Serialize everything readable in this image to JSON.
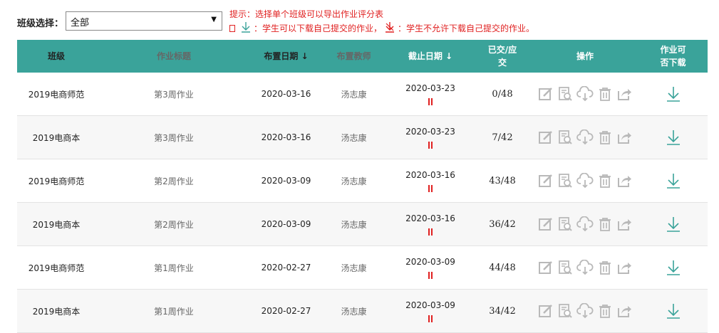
{
  "filter": {
    "label": "班级选择：",
    "selected": "全部",
    "arrow": "▼"
  },
  "hints": {
    "line1": "提示：选择单个班级可以导出作业评分表",
    "allowed_text": "：学生可以下载自己提交的作业，",
    "denied_text": "：学生不允许下载自己提交的作业。"
  },
  "colors": {
    "header_bg": "#3aa39a",
    "hint_red": "#e02020",
    "download_teal": "#3aa39a",
    "icon_gray": "#b9b9b9"
  },
  "table": {
    "headers": {
      "class": "班级",
      "title": "作业标题",
      "assign_date": "布置日期 ↓",
      "teacher": "布置教师",
      "deadline": "截止日期 ↓",
      "submitted_line1": "已交/应",
      "submitted_line2": "交",
      "actions": "操作",
      "downloadable_line1": "作业可",
      "downloadable_line2": "否下载"
    },
    "rows": [
      {
        "class": "2019电商师范",
        "title": "第3周作业",
        "assign_date": "2020-03-16",
        "teacher": "汤志康",
        "deadline": "2020-03-23",
        "submitted": "0/48"
      },
      {
        "class": "2019电商本",
        "title": "第3周作业",
        "assign_date": "2020-03-16",
        "teacher": "汤志康",
        "deadline": "2020-03-23",
        "submitted": "7/42"
      },
      {
        "class": "2019电商师范",
        "title": "第2周作业",
        "assign_date": "2020-03-09",
        "teacher": "汤志康",
        "deadline": "2020-03-16",
        "submitted": "43/48"
      },
      {
        "class": "2019电商本",
        "title": "第2周作业",
        "assign_date": "2020-03-09",
        "teacher": "汤志康",
        "deadline": "2020-03-16",
        "submitted": "36/42"
      },
      {
        "class": "2019电商师范",
        "title": "第1周作业",
        "assign_date": "2020-02-27",
        "teacher": "汤志康",
        "deadline": "2020-03-09",
        "submitted": "44/48"
      },
      {
        "class": "2019电商本",
        "title": "第1周作业",
        "assign_date": "2020-02-27",
        "teacher": "汤志康",
        "deadline": "2020-03-09",
        "submitted": "34/42"
      }
    ]
  }
}
